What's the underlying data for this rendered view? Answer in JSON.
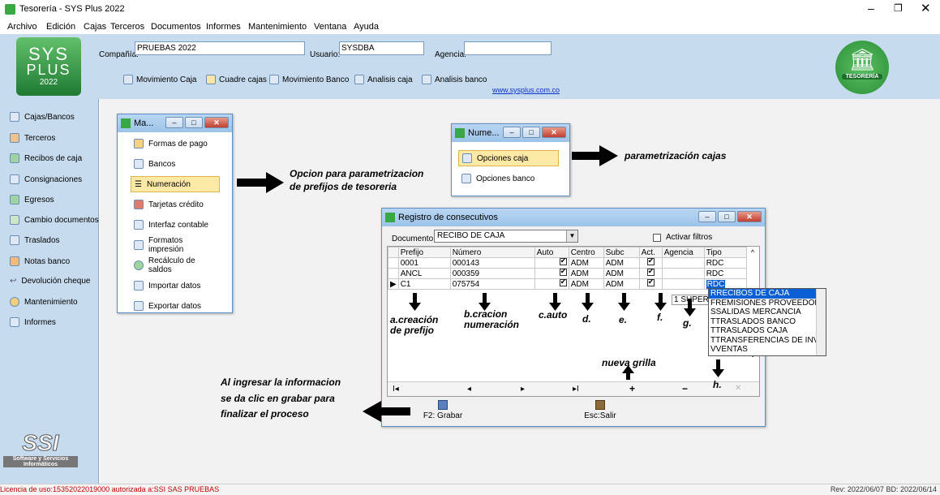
{
  "window": {
    "title": "Tesorería - SYS Plus 2022"
  },
  "menu": [
    "Archivo",
    "Edición",
    "Cajas",
    "Terceros",
    "Documentos",
    "Informes",
    "Mantenimiento",
    "Ventana",
    "Ayuda"
  ],
  "logo": {
    "line1": "SYS",
    "line2": "PLUS",
    "year": "2022",
    "right_badge": "TESORERÍA"
  },
  "header": {
    "company_label": "Compañía:",
    "company_value": "PRUEBAS 2022",
    "user_label": "Usuario:",
    "user_value": "SYSDBA",
    "agency_label": "Agencia:",
    "agency_value": ""
  },
  "toolbar": [
    "Movimiento Caja",
    "Cuadre cajas",
    "Movimiento Banco",
    "Analisis caja",
    "Analisis banco"
  ],
  "website": "www.sysplus.com.co",
  "sidebar": [
    "Cajas/Bancos",
    "Terceros",
    "Recibos de caja",
    "Consignaciones",
    "Egresos",
    "Cambio documentos",
    "Traslados",
    "Notas banco",
    "Devolución cheque",
    "Mantenimiento",
    "Informes"
  ],
  "ssi_logo": {
    "top": "SSI",
    "line1": "Software y Servicios",
    "line2": "Informáticos"
  },
  "status": {
    "left": "Licencia de uso:15352022019000 autorizada a:SSI SAS PRUEBAS",
    "right": "Rev: 2022/06/07 BD: 2022/06/14"
  },
  "menu_window": {
    "title": "Ma...",
    "items": [
      "Formas de pago",
      "Bancos",
      "Numeración",
      "Tarjetas crédito",
      "Interfaz contable",
      "Formatos impresión",
      "Recálculo de saldos",
      "Importar datos",
      "Exportar datos"
    ]
  },
  "num_window": {
    "title": "Nume...",
    "items": [
      "Opciones caja",
      "Opciones banco"
    ]
  },
  "registro": {
    "title": "Registro de consecutivos",
    "doc_label": "Documento:",
    "doc_value": "RECIBO DE CAJA",
    "filter_label": "Activar filtros",
    "columns": [
      "Prefijo",
      "Número",
      "Auto",
      "Centro",
      "Subc",
      "Act.",
      "Agencia",
      "Tipo"
    ],
    "rows": [
      {
        "prefijo": "0001",
        "numero": "000143",
        "centro": "ADM",
        "subc": "ADM",
        "tipo": "RDC"
      },
      {
        "prefijo": "ANCL",
        "numero": "000359",
        "centro": "ADM",
        "subc": "ADM",
        "tipo": "RDC"
      },
      {
        "prefijo": "C1",
        "numero": "075754",
        "centro": "ADM",
        "subc": "ADM",
        "tipo": "RDC"
      }
    ],
    "agency_dropdown": "1 SUPER",
    "tipo_options": [
      "RRECIBOS DE CAJA",
      "FREMISIONES PROVEEDOR",
      "SSALIDAS MERCANCIA",
      "TTRASLADOS BANCO",
      "TTRASLADOS CAJA",
      "TTRANSFERENCIAS DE INVI",
      "VVENTAS"
    ],
    "nav": [
      "I◂",
      "◂",
      "▸",
      "▸I",
      "+",
      "−",
      "✕"
    ],
    "save_label": "F2: Grabar",
    "exit_label": "Esc:Salir"
  },
  "annotations": {
    "a1": "Opcion para parametrizacion",
    "a2": "de prefijos de tesoreria",
    "b": "parametrización cajas",
    "c1": "a.creación",
    "c2": "de prefijo",
    "d1": "b.cracion",
    "d2": "numeración",
    "e": "c.auto",
    "f": "d.",
    "g": "e.",
    "h": "f.",
    "i": "g.",
    "j": "h.",
    "k": "nueva grilla",
    "l1": "Al ingresar la informacion",
    "l2": "se da clic en grabar para",
    "l3": "finalizar el proceso"
  }
}
